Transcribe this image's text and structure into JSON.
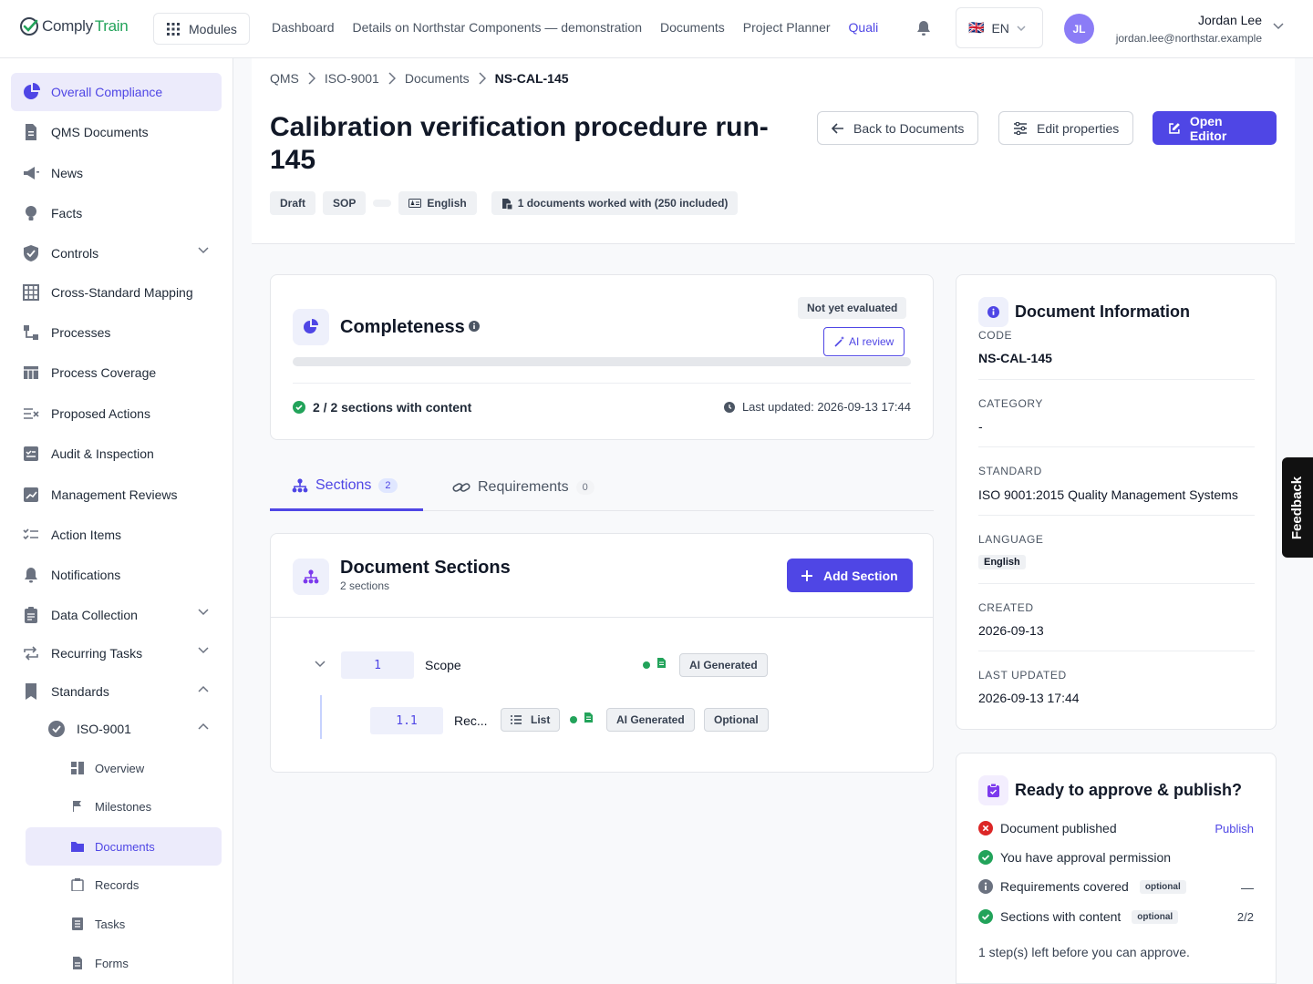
{
  "app": {
    "logo_part1": "Comply",
    "logo_part2": "Train",
    "modules_label": "Modules"
  },
  "topnav": [
    "Dashboard",
    "Details on Northstar Components — demonstration",
    "Documents",
    "Project Planner",
    "Quali"
  ],
  "language": {
    "flag": "🇬🇧",
    "code": "EN"
  },
  "user": {
    "initials": "JL",
    "name": "Jordan Lee",
    "email": "jordan.lee@northstar.example"
  },
  "sidebar": {
    "items": [
      {
        "label": "Overall Compliance",
        "icon": "pie-icon"
      },
      {
        "label": "QMS Documents",
        "icon": "document-icon"
      },
      {
        "label": "News",
        "icon": "megaphone-icon"
      },
      {
        "label": "Facts",
        "icon": "lightbulb-icon"
      },
      {
        "label": "Controls",
        "icon": "shield-icon"
      },
      {
        "label": "Cross-Standard Mapping",
        "icon": "grid-icon"
      },
      {
        "label": "Processes",
        "icon": "process-icon"
      },
      {
        "label": "Process Coverage",
        "icon": "table-icon"
      },
      {
        "label": "Proposed Actions",
        "icon": "actions-icon"
      },
      {
        "label": "Audit & Inspection",
        "icon": "audit-icon"
      },
      {
        "label": "Management Reviews",
        "icon": "review-icon"
      },
      {
        "label": "Action Items",
        "icon": "checklist-icon"
      },
      {
        "label": "Notifications",
        "icon": "bell-icon"
      },
      {
        "label": "Data Collection",
        "icon": "clipboard-icon"
      },
      {
        "label": "Recurring Tasks",
        "icon": "repeat-icon"
      },
      {
        "label": "Standards",
        "icon": "bookmark-icon"
      }
    ],
    "standard": {
      "label": "ISO-9001"
    },
    "sub_items": [
      {
        "label": "Overview"
      },
      {
        "label": "Milestones"
      },
      {
        "label": "Documents"
      },
      {
        "label": "Records"
      },
      {
        "label": "Tasks"
      },
      {
        "label": "Forms"
      }
    ]
  },
  "breadcrumb": [
    "QMS",
    "ISO-9001",
    "Documents",
    "NS-CAL-145"
  ],
  "document": {
    "title": "Calibration verification procedure run-145",
    "chips": {
      "status": "Draft",
      "type": "SOP",
      "language": "English",
      "usage": "1 documents worked with (250 included)"
    }
  },
  "actions": {
    "back": "Back to Documents",
    "edit": "Edit properties",
    "open": "Open Editor"
  },
  "completeness": {
    "title": "Completeness",
    "status": "Not yet evaluated",
    "ai_review": "AI review",
    "progress_fraction": 0,
    "sections_summary": "2 / 2 sections with content",
    "last_updated": "Last updated: 2026-09-13 17:44"
  },
  "tabs": [
    {
      "label": "Sections",
      "count": "2"
    },
    {
      "label": "Requirements",
      "count": "0"
    }
  ],
  "doc_sections": {
    "title": "Document Sections",
    "subtitle": "2 sections",
    "add_label": "Add Section",
    "rows": [
      {
        "number": "1",
        "title": "Scope",
        "tags": [
          "AI Generated"
        ]
      },
      {
        "number": "1.1",
        "title": "Rec...",
        "list_label": "List",
        "tags": [
          "AI Generated",
          "Optional"
        ]
      }
    ]
  },
  "doc_info": {
    "title": "Document Information",
    "fields": [
      {
        "label": "CODE",
        "value": "NS-CAL-145"
      },
      {
        "label": "CATEGORY",
        "value": "-"
      },
      {
        "label": "STANDARD",
        "value": "ISO 9001:2015 Quality Management Systems"
      },
      {
        "label": "LANGUAGE",
        "value": "English"
      },
      {
        "label": "CREATED",
        "value": "2026-09-13"
      },
      {
        "label": "LAST UPDATED",
        "value": "2026-09-13 17:44"
      }
    ]
  },
  "approve": {
    "title": "Ready to approve & publish?",
    "checks": [
      {
        "label": "Document published",
        "state": "fail",
        "action": "Publish"
      },
      {
        "label": "You have approval permission",
        "state": "ok"
      },
      {
        "label": "Requirements covered",
        "state": "info",
        "optional": "optional",
        "value": "—"
      },
      {
        "label": "Sections with content",
        "state": "ok",
        "optional": "optional",
        "value": "2/2"
      }
    ],
    "footer": "1 step(s) left before you can approve."
  },
  "feedback_label": "Feedback",
  "colors": {
    "accent": "#4f46e5",
    "ok": "#22a35a",
    "fail": "#dc2626",
    "logo_green": "#22a35a"
  }
}
